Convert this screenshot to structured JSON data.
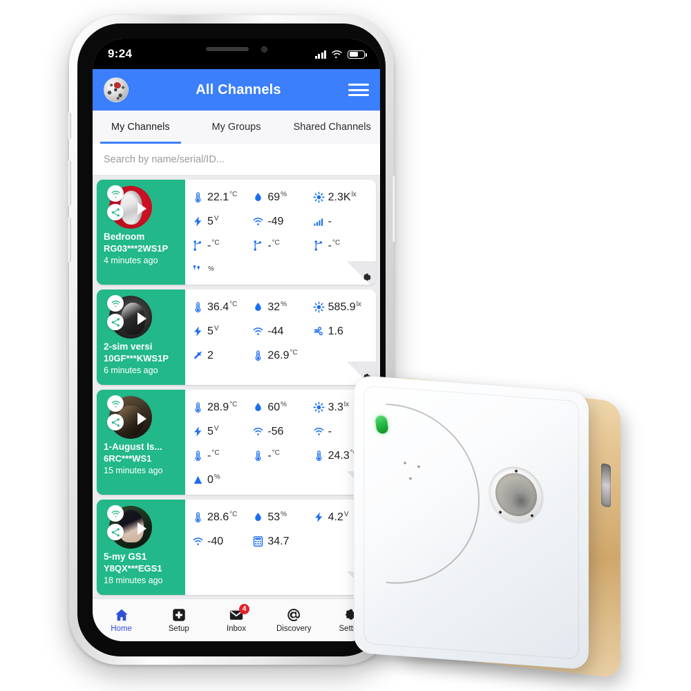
{
  "status_bar": {
    "time": "9:24",
    "signal_icon": "signal-bars-icon",
    "wifi_icon": "wifi-icon",
    "battery_icon": "battery-icon"
  },
  "header": {
    "title": "All Channels",
    "avatar_icon": "user-avatar",
    "menu_icon": "hamburger-menu-icon"
  },
  "tabs": [
    {
      "label": "My Channels",
      "active": true
    },
    {
      "label": "My Groups",
      "active": false
    },
    {
      "label": "Shared Channels",
      "active": false
    }
  ],
  "search": {
    "placeholder": "Search by name/serial/ID...",
    "value": ""
  },
  "colors": {
    "header_blue": "#3b7ffc",
    "card_green": "#22b889",
    "icon_blue": "#1a6ef0",
    "badge_red": "#e4232b",
    "active_nav": "#2f4fd8",
    "device_gold": "#cfa76c",
    "led_green": "#21b43f"
  },
  "channels": [
    {
      "name": "Bedroom",
      "serial": "RG03***2WS1P",
      "time": "4 minutes ago",
      "avatar_style": "kfc",
      "sensors": [
        {
          "icon": "thermometer-icon",
          "value": "22.1",
          "unit": "°C"
        },
        {
          "icon": "humidity-drop-icon",
          "value": "69",
          "unit": "%"
        },
        {
          "icon": "brightness-sun-icon",
          "value": "2.3K",
          "unit": "lx"
        },
        {
          "icon": "voltage-bolt-icon",
          "value": "5",
          "unit": "V"
        },
        {
          "icon": "wifi-icon",
          "value": "-49",
          "unit": ""
        },
        {
          "icon": "signal-bars-icon",
          "value": "-",
          "unit": ""
        },
        {
          "icon": "probe-node-icon",
          "value": "-",
          "unit": "°C"
        },
        {
          "icon": "probe-node-icon",
          "value": "-",
          "unit": "°C"
        },
        {
          "icon": "probe-node-icon",
          "value": "-",
          "unit": "°C"
        },
        {
          "icon": "probe-node-icon",
          "value": "",
          "unit": "%"
        }
      ]
    },
    {
      "name": "2-sim versi",
      "serial": "10GF***KWS1P",
      "time": "6 minutes ago",
      "avatar_style": "photo1",
      "sensors": [
        {
          "icon": "thermometer-icon",
          "value": "36.4",
          "unit": "°C"
        },
        {
          "icon": "humidity-drop-icon",
          "value": "32",
          "unit": "%"
        },
        {
          "icon": "brightness-sun-icon",
          "value": "585.9",
          "unit": "lx"
        },
        {
          "icon": "voltage-bolt-icon",
          "value": "5",
          "unit": "V"
        },
        {
          "icon": "wifi-icon",
          "value": "-44",
          "unit": ""
        },
        {
          "icon": "wind-icon",
          "value": "1.6",
          "unit": ""
        },
        {
          "icon": "hammer-icon",
          "value": "2",
          "unit": ""
        },
        {
          "icon": "thermometer-icon",
          "value": "26.9",
          "unit": "°C"
        }
      ]
    },
    {
      "name": "1-August Is...",
      "serial": "6RC***WS1",
      "time": "15 minutes ago",
      "avatar_style": "photo2",
      "sensors": [
        {
          "icon": "thermometer-icon",
          "value": "28.9",
          "unit": "°C"
        },
        {
          "icon": "humidity-drop-icon",
          "value": "60",
          "unit": "%"
        },
        {
          "icon": "brightness-sun-icon",
          "value": "3.3",
          "unit": "lx"
        },
        {
          "icon": "voltage-bolt-icon",
          "value": "5",
          "unit": "V"
        },
        {
          "icon": "wifi-icon",
          "value": "-56",
          "unit": ""
        },
        {
          "icon": "wifi-icon",
          "value": "-",
          "unit": ""
        },
        {
          "icon": "thermometer-icon",
          "value": "-",
          "unit": "°C"
        },
        {
          "icon": "thermometer-icon",
          "value": "-",
          "unit": "°C"
        },
        {
          "icon": "thermometer-icon",
          "value": "24.3",
          "unit": "°C"
        },
        {
          "icon": "cone-icon",
          "value": "0",
          "unit": "%"
        }
      ]
    },
    {
      "name": "5-my GS1",
      "serial": "Y8QX***EGS1",
      "time": "18 minutes ago",
      "avatar_style": "photo3",
      "sensors": [
        {
          "icon": "thermometer-icon",
          "value": "28.6",
          "unit": "°C"
        },
        {
          "icon": "humidity-drop-icon",
          "value": "53",
          "unit": "%"
        },
        {
          "icon": "voltage-bolt-icon",
          "value": "4.2",
          "unit": "V"
        },
        {
          "icon": "wifi-icon",
          "value": "-40",
          "unit": ""
        },
        {
          "icon": "calculator-icon",
          "value": "34.7",
          "unit": ""
        }
      ]
    },
    {
      "name": "",
      "serial": "",
      "time": "",
      "avatar_style": "photo4",
      "sensors": []
    }
  ],
  "bottom_nav": [
    {
      "label": "Home",
      "icon": "home-icon",
      "active": true,
      "badge": ""
    },
    {
      "label": "Setup",
      "icon": "plus-box-icon",
      "active": false,
      "badge": ""
    },
    {
      "label": "Inbox",
      "icon": "envelope-icon",
      "active": false,
      "badge": "4"
    },
    {
      "label": "Discovery",
      "icon": "at-sign-icon",
      "active": false,
      "badge": ""
    },
    {
      "label": "Setting",
      "icon": "gear-icon",
      "active": false,
      "badge": ""
    }
  ],
  "device": {
    "name": "white-square-sensor-device",
    "led_indicator": "green-led-indicator",
    "sensor_port": "circular-sensor-port",
    "usb_port": "usb-port"
  }
}
